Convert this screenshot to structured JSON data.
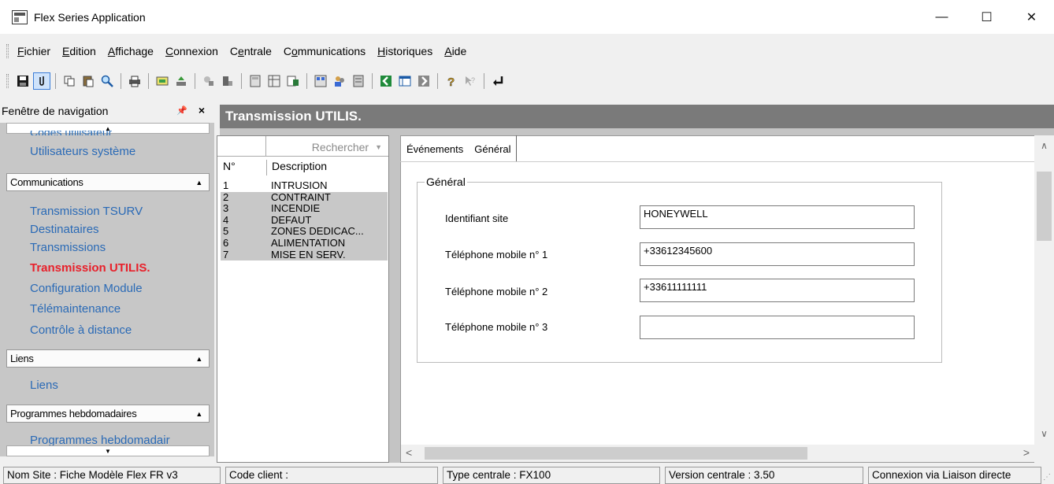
{
  "window": {
    "title": "Flex Series Application",
    "minimize": "—",
    "maximize": "☐",
    "close": "✕"
  },
  "menu": [
    {
      "u": "F",
      "rest": "ichier"
    },
    {
      "u": "E",
      "rest": "dition"
    },
    {
      "u": "A",
      "rest": "ffichage"
    },
    {
      "u": "C",
      "rest": "onnexion"
    },
    {
      "pre": "C",
      "u": "e",
      "rest": "ntrale"
    },
    {
      "pre": "C",
      "u": "o",
      "rest": "mmunications"
    },
    {
      "u": "H",
      "rest": "istoriques"
    },
    {
      "u": "A",
      "rest": "ide"
    }
  ],
  "toolbar_icons": [
    "save-icon",
    "attach-icon",
    "copy-icon",
    "paste-icon",
    "search-icon",
    "print-icon",
    "connect-icon",
    "upload-icon",
    "tools-icon",
    "download-icon",
    "calc-icon",
    "grid-icon",
    "report-icon",
    "panel-icon",
    "users-icon",
    "list-icon",
    "back-icon",
    "view-icon",
    "forward-icon",
    "help-icon",
    "context-help-icon",
    "enter-icon"
  ],
  "nav": {
    "header": "Fenêtre de navigation",
    "pin": "📌",
    "close": "×",
    "cut_item": "Codes utilisateur",
    "items_top": [
      "Utilisateurs système"
    ],
    "groups": [
      {
        "label": "Communications",
        "items": [
          "Transmission TSURV",
          "Destinataires",
          "Transmissions",
          "Transmission UTILIS.",
          "Configuration Module",
          "Télémaintenance",
          "Contrôle à distance"
        ]
      },
      {
        "label": "Liens",
        "items": [
          "Liens"
        ]
      },
      {
        "label": "Programmes hebdomadaires",
        "items": [
          "Programmes hebdomadair"
        ]
      }
    ],
    "active_item": "Transmission UTILIS."
  },
  "panel": {
    "title": "Transmission UTILIS.",
    "search_label": "Rechercher",
    "list_headers": {
      "num": "N°",
      "desc": "Description"
    },
    "rows": [
      {
        "n": "1",
        "d": "INTRUSION"
      },
      {
        "n": "2",
        "d": "CONTRAINT"
      },
      {
        "n": "3",
        "d": "INCENDIE"
      },
      {
        "n": "4",
        "d": "DEFAUT"
      },
      {
        "n": "5",
        "d": "ZONES DEDICAC..."
      },
      {
        "n": "6",
        "d": "ALIMENTATION"
      },
      {
        "n": "7",
        "d": "MISE EN SERV."
      }
    ],
    "tabs": {
      "events": "Événements",
      "general": "Général"
    },
    "group_title": "Général",
    "fields": [
      {
        "label": "Identifiant site",
        "value": "HONEYWELL"
      },
      {
        "label": "Téléphone mobile n° 1",
        "value": "+33612345600"
      },
      {
        "label": "Téléphone mobile n° 2",
        "value": "+33611111111"
      },
      {
        "label": "Téléphone mobile n° 3",
        "value": ""
      }
    ]
  },
  "status": {
    "site": "Nom Site : Fiche Modèle Flex FR v3",
    "client": "Code client :",
    "type": "Type centrale : FX100",
    "version": "Version centrale : 3.50",
    "connection": "Connexion via Liaison directe"
  }
}
